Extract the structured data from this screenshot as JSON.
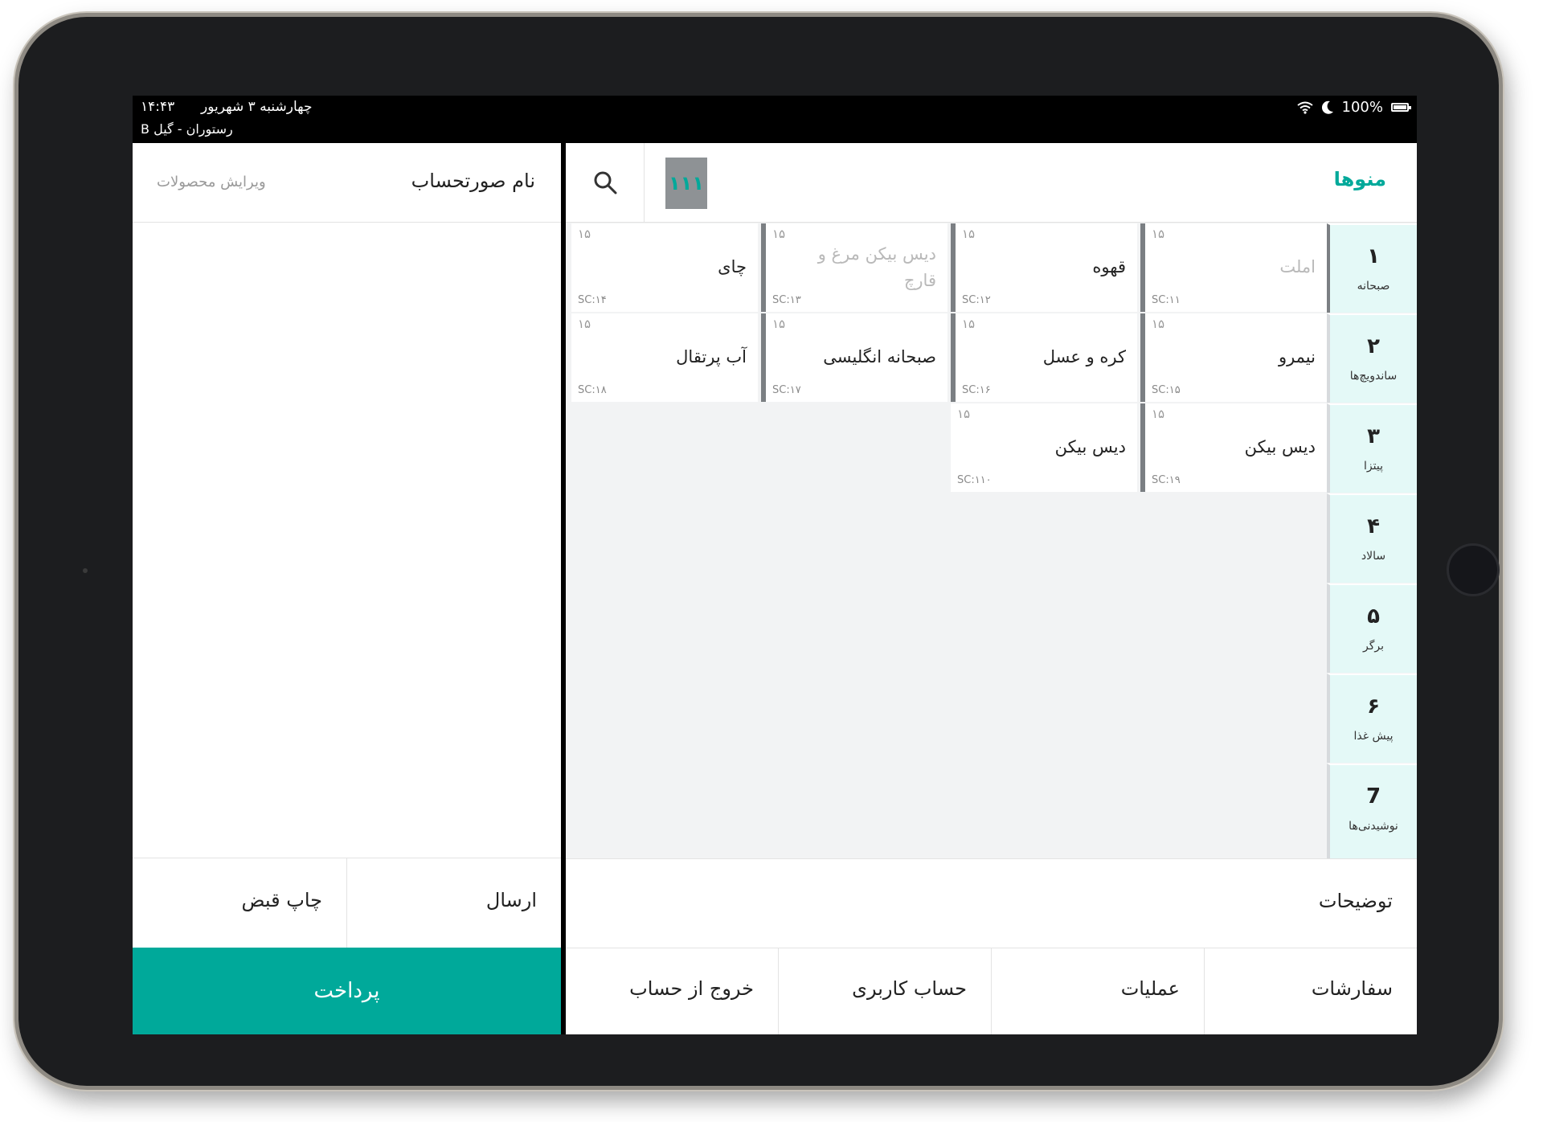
{
  "status_bar": {
    "date": "چهارشنبه ۳ شهریور",
    "time": "۱۴:۴۳",
    "place": "رستوران - گیل B",
    "battery": "100%",
    "icons": [
      "wifi-icon",
      "moon-icon",
      "battery-icon"
    ]
  },
  "invoice": {
    "title": "نام صورتحساب",
    "edit_label": "ویرایش محصولات",
    "send_label": "ارسال",
    "print_label": "چاپ قبض",
    "pay_label": "پرداخت"
  },
  "menu": {
    "title": "منوها",
    "grid_button": "۱۱۱",
    "notes_label": "توضیحات",
    "items": [
      {
        "name": "املت",
        "price": "۱۵",
        "sc": "SC:۱۱",
        "disabled": true
      },
      {
        "name": "قهوه",
        "price": "۱۵",
        "sc": "SC:۱۲",
        "disabled": false
      },
      {
        "name": "دیس بیکن مرغ و قارچ",
        "price": "۱۵",
        "sc": "SC:۱۳",
        "disabled": true
      },
      {
        "name": "چای",
        "price": "۱۵",
        "sc": "SC:۱۴",
        "disabled": false
      },
      {
        "name": "نیمرو",
        "price": "۱۵",
        "sc": "SC:۱۵",
        "disabled": false
      },
      {
        "name": "کره و عسل",
        "price": "۱۵",
        "sc": "SC:۱۶",
        "disabled": false
      },
      {
        "name": "صبحانه انگلیسی",
        "price": "۱۵",
        "sc": "SC:۱۷",
        "disabled": false
      },
      {
        "name": "آب پرتقال",
        "price": "۱۵",
        "sc": "SC:۱۸",
        "disabled": false
      },
      {
        "name": "دیس بیکن",
        "price": "۱۵",
        "sc": "SC:۱۹",
        "disabled": false
      },
      {
        "name": "دیس بیکن",
        "price": "۱۵",
        "sc": "SC:۱۱۰",
        "disabled": false
      }
    ],
    "categories": [
      {
        "num": "۱",
        "label": "صبحانه"
      },
      {
        "num": "۲",
        "label": "ساندویچ‌ها"
      },
      {
        "num": "۳",
        "label": "پیتزا"
      },
      {
        "num": "۴",
        "label": "سالاد"
      },
      {
        "num": "۵",
        "label": "برگر"
      },
      {
        "num": "۶",
        "label": "پیش غذا"
      },
      {
        "num": "7",
        "label": "نوشیدنی‌ها"
      }
    ]
  },
  "bottom_nav": {
    "orders": "سفارشات",
    "operations": "عملیات",
    "account": "حساب کاربری",
    "logout": "خروج از حساب"
  },
  "colors": {
    "accent": "#00a99a",
    "category_bg": "#e4f9f7",
    "item_border": "#7b7f83"
  }
}
